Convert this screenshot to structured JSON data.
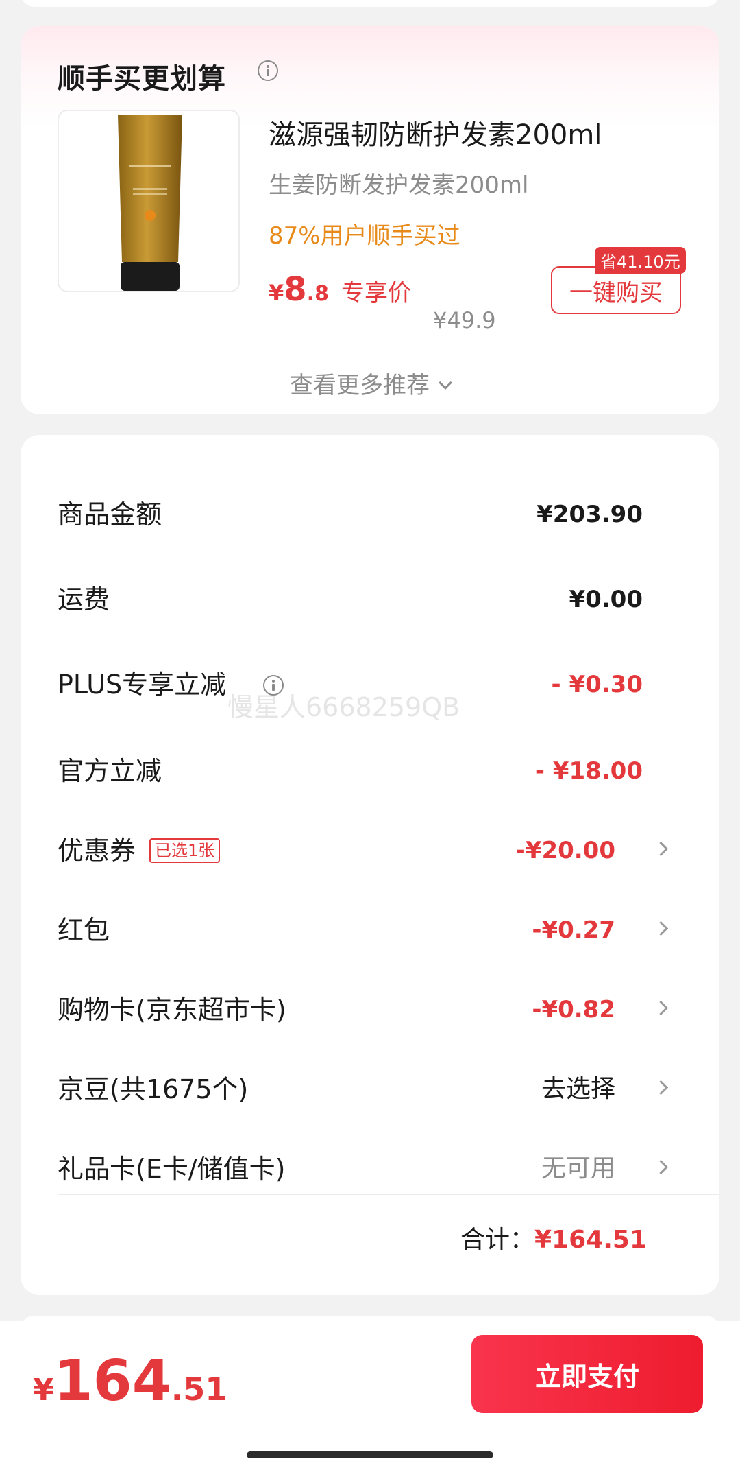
{
  "recommend": {
    "title": "顺手买更划算",
    "product": {
      "name": "滋源强韧防断护发素200ml",
      "subtitle": "生姜防断发护发素200ml",
      "hint": "87%用户顺手买过",
      "price_symbol": "¥",
      "price_int": "8",
      "price_dec": ".8",
      "price_tag": "专享价",
      "original_price": "¥49.9",
      "save_badge": "省41.10元",
      "buy_label": "一键购买"
    },
    "more_label": "查看更多推荐"
  },
  "summary": {
    "rows": [
      {
        "label": "商品金额",
        "value": "¥203.90"
      },
      {
        "label": "运费",
        "value": "¥0.00"
      },
      {
        "label": "PLUS专享立减",
        "value": "- ¥0.30"
      },
      {
        "label": "官方立减",
        "value": "- ¥18.00"
      },
      {
        "label": "优惠券",
        "tag": "已选1张",
        "value": "-¥20.00"
      },
      {
        "label": "红包",
        "value": "-¥0.27"
      },
      {
        "label": "购物卡(京东超市卡)",
        "value": "-¥0.82"
      },
      {
        "label": "京豆(共1675个)",
        "value": "去选择"
      },
      {
        "label": "礼品卡(E卡/储值卡)",
        "value": "无可用"
      }
    ],
    "total_label": "合计：",
    "total_value": "¥164.51"
  },
  "watermark": "慢星人6668259QB",
  "footer": {
    "pay_symbol": "¥",
    "pay_int": "164",
    "pay_dec": ".51",
    "pay_button": "立即支付"
  },
  "colors": {
    "accent_red": "#e4393c",
    "hint_orange": "#e88a1a",
    "pay_button": "#f9344d"
  }
}
